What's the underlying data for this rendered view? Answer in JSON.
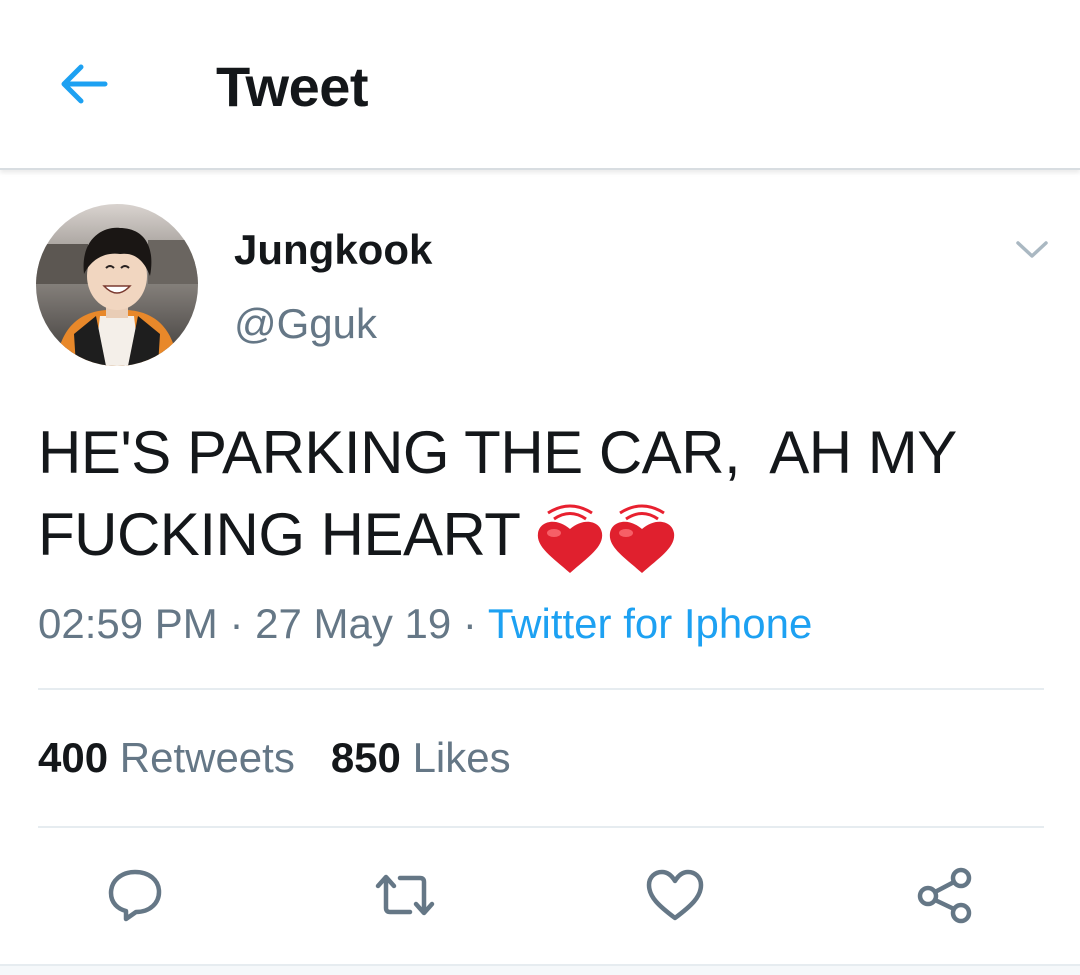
{
  "header": {
    "title": "Tweet",
    "back_icon": "arrow-left-icon",
    "accent_color": "#1da1f2"
  },
  "tweet": {
    "author": {
      "display_name": "Jungkook",
      "handle": "@Gguk"
    },
    "text_line1": "HE'S PARKING THE CAR,  AH MY",
    "text_line2": "FUCKING HEART",
    "emoji": [
      "beating-heart-icon",
      "beating-heart-icon"
    ],
    "time": "02:59 PM",
    "date": "27 May 19",
    "separator": "·",
    "source": "Twitter for Iphone",
    "retweets_count": "400",
    "retweets_label": "Retweets",
    "likes_count": "850",
    "likes_label": "Likes"
  },
  "actions": [
    "reply-icon",
    "retweet-icon",
    "like-icon",
    "share-icon"
  ],
  "colors": {
    "text": "#14171a",
    "secondary": "#657786",
    "link": "#1da1f2",
    "divider": "#e6ecf0"
  }
}
